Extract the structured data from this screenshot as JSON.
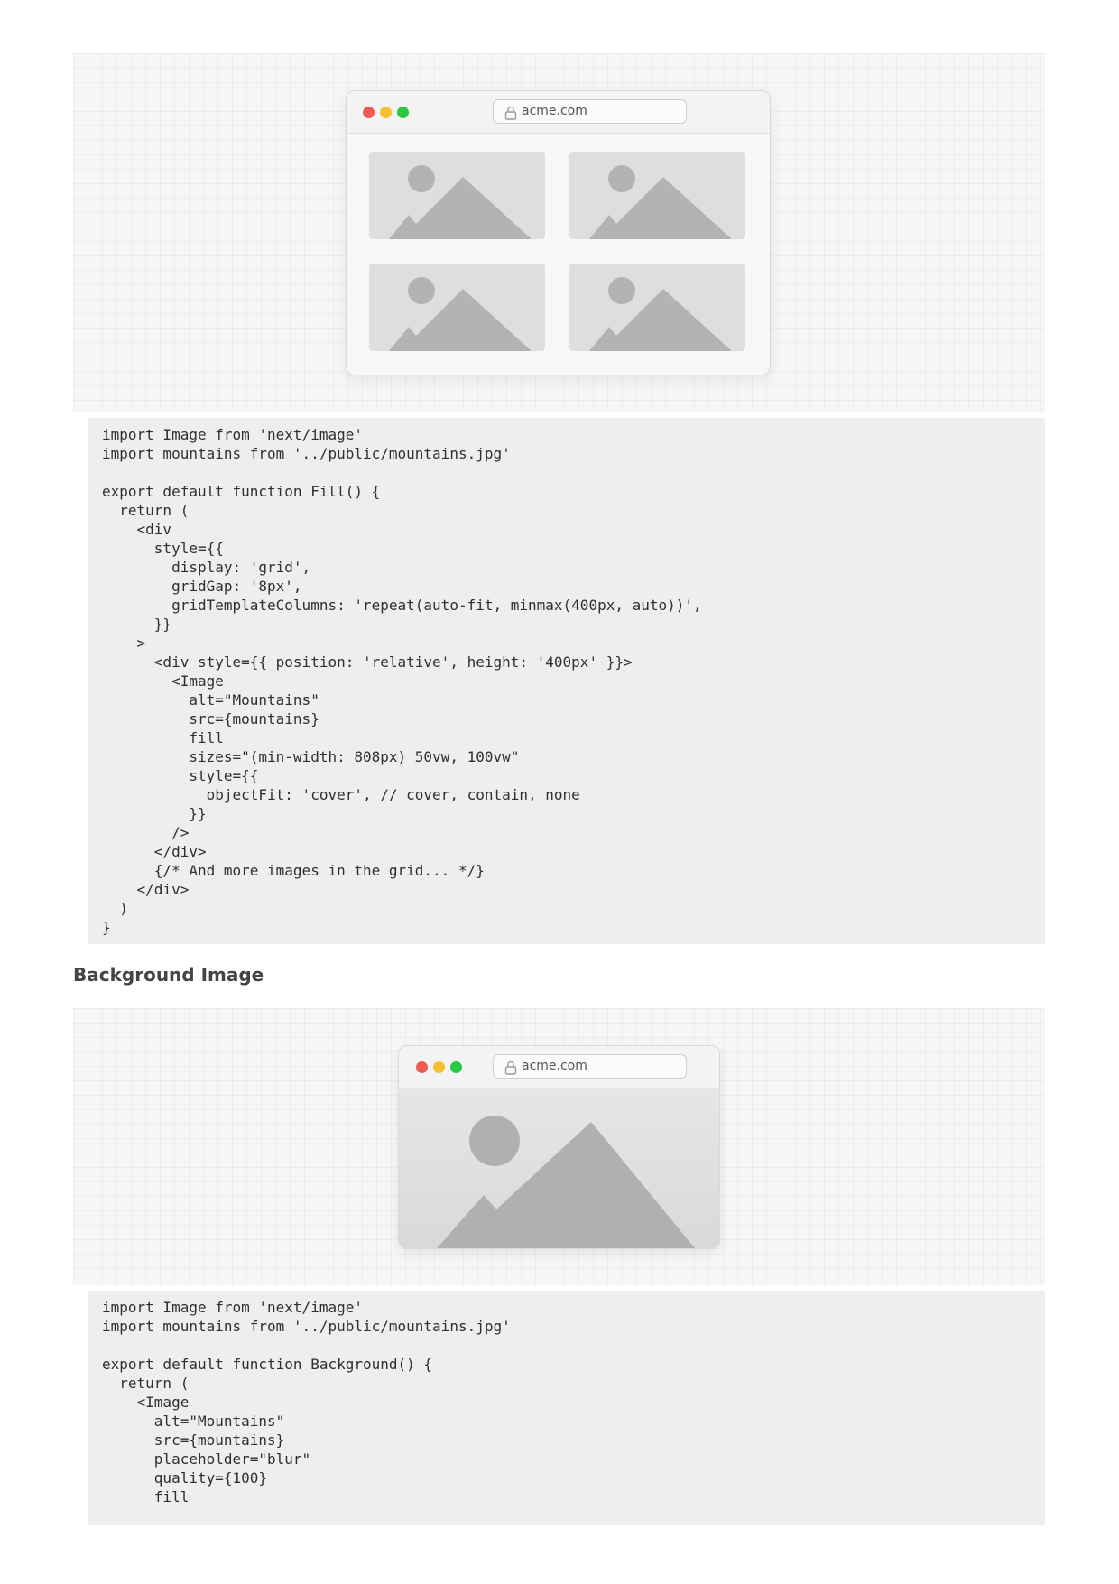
{
  "figure1": {
    "url": "acme.com",
    "image_icons": [
      "image-placeholder-icon",
      "image-placeholder-icon",
      "image-placeholder-icon",
      "image-placeholder-icon"
    ]
  },
  "code_fill": [
    "import Image from 'next/image'",
    "import mountains from '../public/mountains.jpg'",
    "",
    "export default function Fill() {",
    "  return (",
    "    <div",
    "      style={{",
    "        display: 'grid',",
    "        gridGap: '8px',",
    "        gridTemplateColumns: 'repeat(auto-fit, minmax(400px, auto))',",
    "      }}",
    "    >",
    "      <div style={{ position: 'relative', height: '400px' }}>",
    "        <Image",
    "          alt=\"Mountains\"",
    "          src={mountains}",
    "          fill",
    "          sizes=\"(min-width: 808px) 50vw, 100vw\"",
    "          style={{",
    "            objectFit: 'cover', // cover, contain, none",
    "          }}",
    "        />",
    "      </div>",
    "      {/* And more images in the grid... */}",
    "    </div>",
    "  )",
    "}"
  ],
  "section_heading": "Background Image",
  "figure2": {
    "url": "acme.com",
    "image_icon": "image-placeholder-icon"
  },
  "code_background": [
    "import Image from 'next/image'",
    "import mountains from '../public/mountains.jpg'",
    "",
    "export default function Background() {",
    "  return (",
    "    <Image",
    "      alt=\"Mountains\"",
    "      src={mountains}",
    "      placeholder=\"blur\"",
    "      quality={100}",
    "      fill"
  ],
  "colors": {
    "traffic_red": "#ee5a52",
    "traffic_yellow": "#f5bf2f",
    "traffic_green": "#29c941",
    "code_bg": "#eeeeee"
  }
}
